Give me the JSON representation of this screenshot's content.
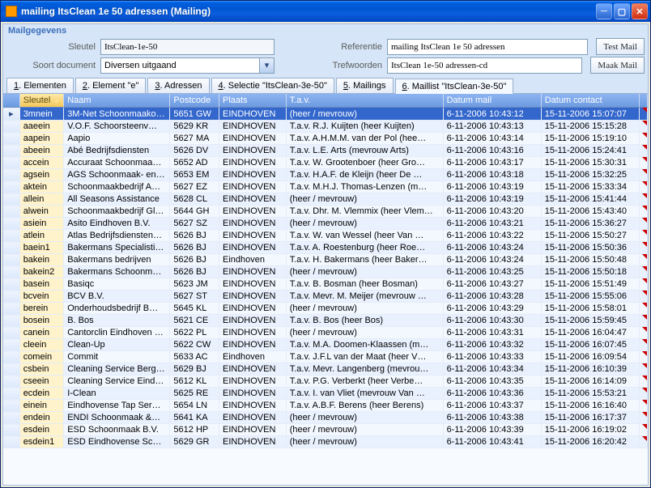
{
  "window": {
    "title": "mailing ItsClean 1e 50 adressen (Mailing)"
  },
  "group_header": "Mailgegevens",
  "form": {
    "sleutel_label": "Sleutel",
    "sleutel_value": "ItsClean-1e-50",
    "soort_label": "Soort document",
    "soort_value": "Diversen uitgaand",
    "referentie_label": "Referentie",
    "referentie_value": "mailing ItsClean 1e 50 adressen",
    "trefwoorden_label": "Trefwoorden",
    "trefwoorden_value": "ItsClean 1e-50 adressen-cd",
    "test_mail_label": "Test Mail",
    "maak_mail_label": "Maak Mail"
  },
  "tabs": [
    {
      "accel": "1",
      "label": ". Elementen"
    },
    {
      "accel": "2",
      "label": ". Element \"e\""
    },
    {
      "accel": "3",
      "label": ". Adressen"
    },
    {
      "accel": "4",
      "label": ". Selectie \"ItsClean-3e-50\""
    },
    {
      "accel": "5",
      "label": ". Mailings"
    },
    {
      "accel": "6",
      "label": ". Maillist \"ItsClean-3e-50\""
    }
  ],
  "active_tab_index": 5,
  "columns": [
    "Sleutel",
    "Naam",
    "Postcode",
    "Plaats",
    "T.a.v.",
    "Datum mail",
    "Datum contact"
  ],
  "sort_column": 0,
  "rows": [
    [
      "3mnein",
      "3M-Net Schoonmaako…",
      "5651 GW",
      "EINDHOVEN",
      "(heer / mevrouw)",
      "6-11-2006 10:43:12",
      "15-11-2006 15:07:07"
    ],
    [
      "aaeein",
      "V.O.F. Schoorsteenv…",
      "5629 KR",
      "EINDHOVEN",
      "T.a.v. R.J. Kuijten (heer Kuijten)",
      "6-11-2006 10:43:13",
      "15-11-2006 15:15:28"
    ],
    [
      "aapein",
      "Aapio",
      "5627 MA",
      "EINDHOVEN",
      "T.a.v. A.H.M.M. van der Pol (hee…",
      "6-11-2006 10:43:14",
      "15-11-2006 15:19:10"
    ],
    [
      "abeein",
      "Abé Bedrijfsdiensten",
      "5626 DV",
      "EINDHOVEN",
      "T.a.v. L.E. Arts (mevrouw Arts)",
      "6-11-2006 10:43:16",
      "15-11-2006 15:24:41"
    ],
    [
      "accein",
      "Accuraat Schoonmaa…",
      "5652 AD",
      "EINDHOVEN",
      "T.a.v. W. Grootenboer (heer Gro…",
      "6-11-2006 10:43:17",
      "15-11-2006 15:30:31"
    ],
    [
      "agsein",
      "AGS Schoonmaak- en…",
      "5653 EM",
      "EINDHOVEN",
      "T.a.v. H.A.F. de Kleijn (heer De …",
      "6-11-2006 10:43:18",
      "15-11-2006 15:32:25"
    ],
    [
      "aktein",
      "Schoonmaakbedrijf A…",
      "5627 EZ",
      "EINDHOVEN",
      "T.a.v. M.H.J. Thomas-Lenzen (m…",
      "6-11-2006 10:43:19",
      "15-11-2006 15:33:34"
    ],
    [
      "allein",
      "All Seasons Assistance",
      "5628 CL",
      "EINDHOVEN",
      "(heer / mevrouw)",
      "6-11-2006 10:43:19",
      "15-11-2006 15:41:44"
    ],
    [
      "alwein",
      "Schoonmaakbedrijf Gl…",
      "5644 GH",
      "EINDHOVEN",
      "T.a.v. Dhr. M. Vlemmix (heer Vlem…",
      "6-11-2006 10:43:20",
      "15-11-2006 15:43:40"
    ],
    [
      "asiein",
      "Asito Eindhoven B.V.",
      "5627 SZ",
      "EINDHOVEN",
      "(heer / mevrouw)",
      "6-11-2006 10:43:21",
      "15-11-2006 15:36:27"
    ],
    [
      "atlein",
      "Atlas Bedrijfsdiensten…",
      "5626 BJ",
      "EINDHOVEN",
      "T.a.v. W. van Wessel (heer Van …",
      "6-11-2006 10:43:22",
      "15-11-2006 15:50:27"
    ],
    [
      "baein1",
      "Bakermans Specialisti…",
      "5626 BJ",
      "EINDHOVEN",
      "T.a.v. A. Roestenburg (heer Roe…",
      "6-11-2006 10:43:24",
      "15-11-2006 15:50:36"
    ],
    [
      "bakein",
      "Bakermans bedrijven",
      "5626 BJ",
      "Eindhoven",
      "T.a.v. H. Bakermans (heer Baker…",
      "6-11-2006 10:43:24",
      "15-11-2006 15:50:48"
    ],
    [
      "bakein2",
      "Bakermans Schoonma…",
      "5626 BJ",
      "EINDHOVEN",
      "(heer / mevrouw)",
      "6-11-2006 10:43:25",
      "15-11-2006 15:50:18"
    ],
    [
      "basein",
      "Basiqc",
      "5623 JM",
      "EINDHOVEN",
      "T.a.v. B. Bosman (heer Bosman)",
      "6-11-2006 10:43:27",
      "15-11-2006 15:51:49"
    ],
    [
      "bcvein",
      "BCV B.V.",
      "5627 ST",
      "EINDHOVEN",
      "T.a.v. Mevr. M. Meijer (mevrouw …",
      "6-11-2006 10:43:28",
      "15-11-2006 15:55:06"
    ],
    [
      "berein",
      "Onderhoudsbedrijf B…",
      "5645 KL",
      "EINDHOVEN",
      "(heer / mevrouw)",
      "6-11-2006 10:43:29",
      "15-11-2006 15:58:01"
    ],
    [
      "bosein",
      "B. Bos",
      "5621 CE",
      "EINDHOVEN",
      "T.a.v. B. Bos (heer Bos)",
      "6-11-2006 10:43:30",
      "15-11-2006 15:59:45"
    ],
    [
      "canein",
      "Cantorclin Eindhoven …",
      "5622 PL",
      "EINDHOVEN",
      "(heer / mevrouw)",
      "6-11-2006 10:43:31",
      "15-11-2006 16:04:47"
    ],
    [
      "cleein",
      "Clean-Up",
      "5622 CW",
      "EINDHOVEN",
      "T.a.v. M.A. Doomen-Klaassen (m…",
      "6-11-2006 10:43:32",
      "15-11-2006 16:07:45"
    ],
    [
      "comein",
      "Commit",
      "5633 AC",
      "Eindhoven",
      "T.a.v. J.F.L van der Maat (heer V…",
      "6-11-2006 10:43:33",
      "15-11-2006 16:09:54"
    ],
    [
      "csbein",
      "Cleaning Service Berg…",
      "5629 BJ",
      "EINDHOVEN",
      "T.a.v. Mevr. Langenberg (mevrou…",
      "6-11-2006 10:43:34",
      "15-11-2006 16:10:39"
    ],
    [
      "cseein",
      "Cleaning Service Eind…",
      "5612 KL",
      "EINDHOVEN",
      "T.a.v. P.G. Verberkt (heer Verbe…",
      "6-11-2006 10:43:35",
      "15-11-2006 16:14:09"
    ],
    [
      "ecdein",
      "I-Clean",
      "5625 RE",
      "EINDHOVEN",
      "T.a.v. I. van Vliet (mevrouw Van …",
      "6-11-2006 10:43:36",
      "15-11-2006 15:53:21"
    ],
    [
      "einein",
      "Eindhovense Tap Ser…",
      "5654 LN",
      "EINDHOVEN",
      "T.a.v. A.B.F. Berens (heer Berens)",
      "6-11-2006 10:43:37",
      "15-11-2006 16:16:40"
    ],
    [
      "endein",
      "ENDI Schoonmaak &…",
      "5641 KA",
      "EINDHOVEN",
      "(heer / mevrouw)",
      "6-11-2006 10:43:38",
      "15-11-2006 16:17:37"
    ],
    [
      "esdein",
      "ESD Schoonmaak B.V.",
      "5612 HP",
      "EINDHOVEN",
      "(heer / mevrouw)",
      "6-11-2006 10:43:39",
      "15-11-2006 16:19:02"
    ],
    [
      "esdein1",
      "ESD Eindhovense Sch…",
      "5629 GR",
      "EINDHOVEN",
      "(heer / mevrouw)",
      "6-11-2006 10:43:41",
      "15-11-2006 16:20:42"
    ]
  ],
  "selected_row_index": 0
}
